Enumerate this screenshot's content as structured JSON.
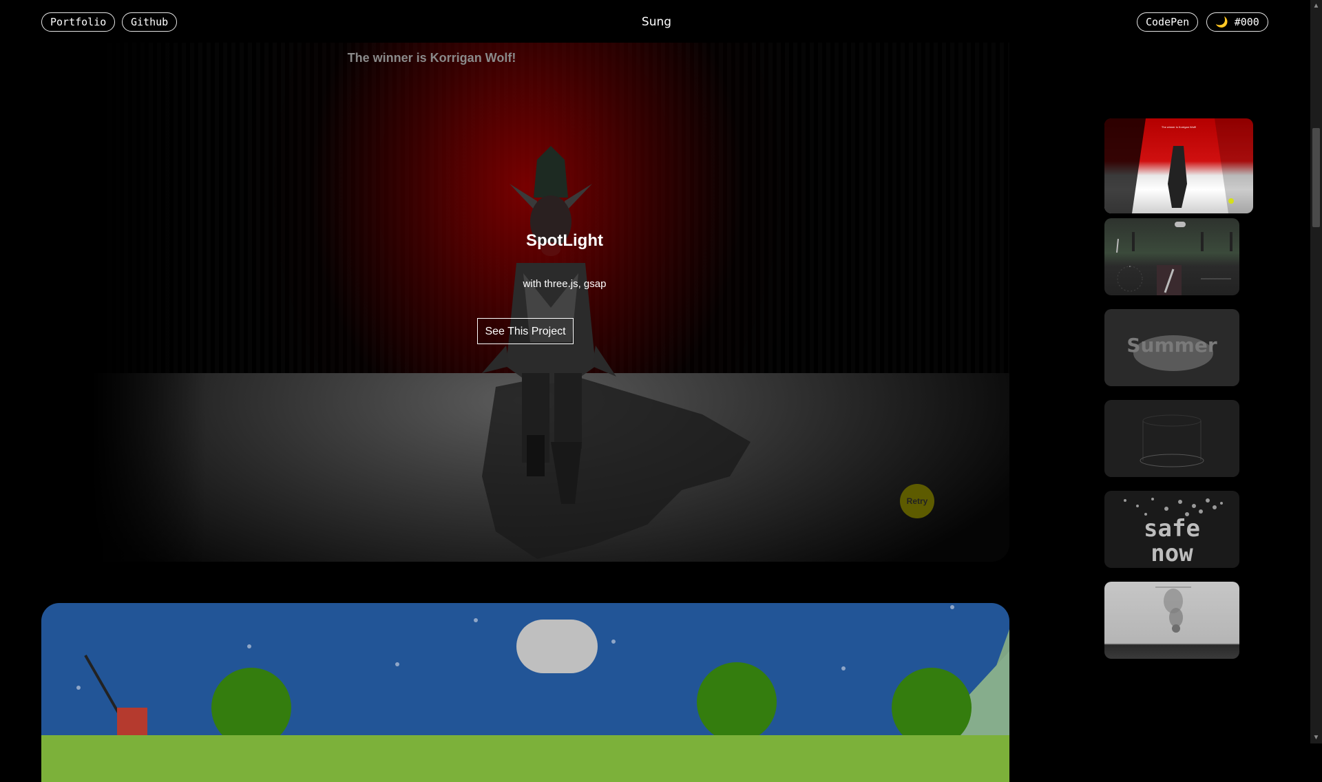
{
  "header": {
    "portfolio_label": "Portfolio",
    "github_label": "Github",
    "site_title": "Sung",
    "codepen_label": "CodePen",
    "theme_icon": "moon-icon",
    "theme_label": "🌙 #000"
  },
  "hero": {
    "banner": "The winner is Korrigan Wolf!",
    "title": "SpotLight",
    "subtitle": "with three.js, gsap",
    "cta_label": "See This Project",
    "retry_label": "Retry"
  },
  "thumbnails": [
    {
      "name": "spotlight",
      "caption": "The winner is Korrigan Wolf!",
      "active": true
    },
    {
      "name": "game-scene",
      "active": false
    },
    {
      "name": "summer",
      "text": "Summer",
      "active": false
    },
    {
      "name": "ring-3d",
      "active": false
    },
    {
      "name": "safe-now",
      "text": "safe now",
      "active": false
    },
    {
      "name": "smoke",
      "active": false
    }
  ],
  "colors": {
    "background": "#000000",
    "spotlight_red": "#8c0000",
    "sky_blue": "#225597",
    "grass_green": "#347d0e",
    "retry_olive": "#5d5b00"
  }
}
